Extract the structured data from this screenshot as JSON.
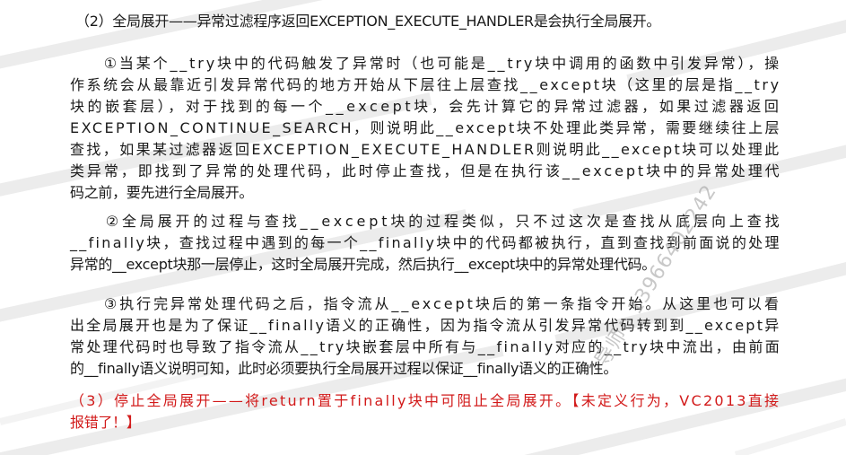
{
  "heading": "（2）全局展开——异常过滤程序返回EXCEPTION_EXECUTE_HANDLER是会执行全局展开。",
  "para1": {
    "lines": [
      "　　①当某个__try块中的代码触发了异常时（也可能是__try块中调用的函数中引发异常），操",
      "作系统会从最靠近引发异常代码的地方开始从下层往上层查找__except块（这里的层是指__try",
      "块的嵌套层），对于找到的每一个__except块，会先计算它的异常过滤器，如果过滤器返回",
      "EXCEPTION_CONTINUE_SEARCH，则说明此__except块不处理此类异常，需要继续往上层",
      "查找，如果某过滤器返回EXCEPTION_EXECUTE_HANDLER则说明此__except块可以处理此",
      "类异常，即找到了异常的处理代码，此时停止查找，但是在执行该__except块中的异常处理代",
      "码之前，要先进行全局展开。"
    ]
  },
  "para2": {
    "lines": [
      "　　②全局展开的过程与查找__except块的过程类似，只不过这次是查找从底层向上查找",
      "__finally块，查找过程中遇到的每一个__finally块中的代码都被执行，直到查找到前面说的处理",
      "异常的__except块那一层停止，这时全局展开完成，然后执行__except块中的异常处理代码。"
    ]
  },
  "para3": {
    "lines": [
      "　　③执行完异常处理代码之后，指令流从__except块后的第一条指令开始。从这里也可以看",
      "出全局展开也是为了保证__finally语义的正确性，因为指令流从引发异常代码转到到__except异",
      "常处理代码时也导致了指令流从__try块嵌套层中所有与__finally对应的__try块中流出，由前面",
      "的__finally语义说明可知，此时必须要执行全局展开过程以保证__finally语义的正确性。"
    ]
  },
  "note": {
    "lines": [
      "（3）停止全局展开——将return置于finally块中可阻止全局展开。【未定义行为，VC2013直接",
      "报错了！】"
    ],
    "color": "#d21a1a"
  },
  "watermark": {
    "text": "导师：13966402242",
    "color": "#9a9a9a"
  }
}
